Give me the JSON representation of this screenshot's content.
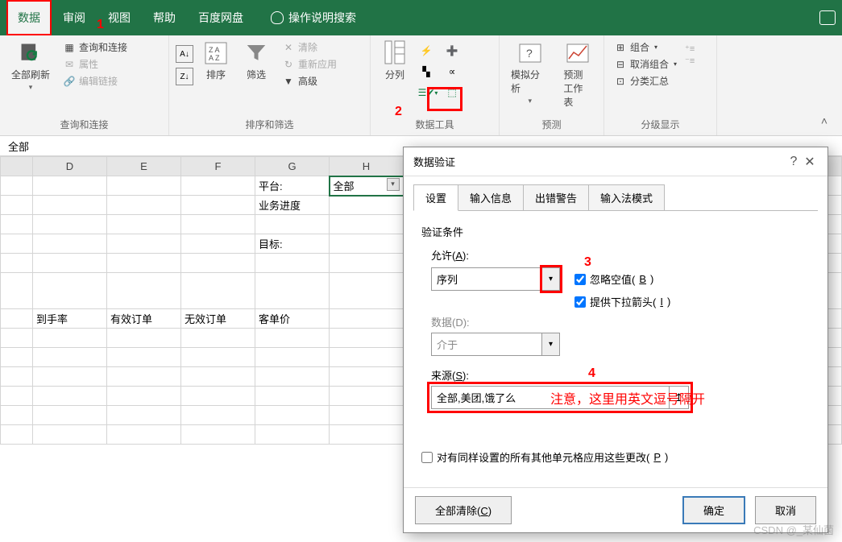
{
  "menu": {
    "active": "数据",
    "items": [
      "数据",
      "审阅",
      "视图",
      "帮助",
      "百度网盘"
    ],
    "tellme": "操作说明搜索"
  },
  "ribbon": {
    "group1": {
      "label": "查询和连接",
      "refreshAll": "全部刷新",
      "queries": "查询和连接",
      "props": "属性",
      "editLinks": "编辑链接"
    },
    "group2": {
      "label": "排序和筛选",
      "sort": "排序",
      "filter": "筛选",
      "clear": "清除",
      "reapply": "重新应用",
      "advanced": "高级"
    },
    "group3": {
      "label": "数据工具",
      "textToCols": "分列"
    },
    "group4": {
      "label": "预测",
      "whatif": "模拟分析",
      "forecast": "预测\n工作表"
    },
    "group5": {
      "label": "分级显示",
      "group": "组合",
      "ungroup": "取消组合",
      "subtotal": "分类汇总"
    }
  },
  "namebar": {
    "value": "全部"
  },
  "sheet": {
    "cols": [
      "",
      "D",
      "E",
      "F",
      "G",
      "H",
      ""
    ],
    "r1": {
      "g": "平台:",
      "h": "全部"
    },
    "r2": {
      "g": "业务进度"
    },
    "r3": {
      "g": "目标:"
    },
    "r4": {
      "c1": "到手率",
      "c2": "有效订单",
      "c3": "无效订单",
      "c4": "客单价"
    }
  },
  "dialog": {
    "title": "数据验证",
    "tabs": [
      "设置",
      "输入信息",
      "出错警告",
      "输入法模式"
    ],
    "activeTab": "设置",
    "section": "验证条件",
    "allowLabel": "允许(A):",
    "allowValue": "序列",
    "ignoreBlank": "忽略空值(B)",
    "dropdown": "提供下拉箭头(I)",
    "dataLabel": "数据(D):",
    "dataValue": "介于",
    "sourceLabel": "来源(S):",
    "sourceValue": "全部,美团,饿了么",
    "applyOthers": "对有同样设置的所有其他单元格应用这些更改(P)",
    "clearAll": "全部清除(C)",
    "ok": "确定",
    "cancel": "取消"
  },
  "annotations": {
    "n1": "1",
    "n2": "2",
    "n3": "3",
    "n4": "4",
    "note": "注意，这里用英文逗号隔开"
  },
  "watermark": "CSDN @_某仙菌"
}
